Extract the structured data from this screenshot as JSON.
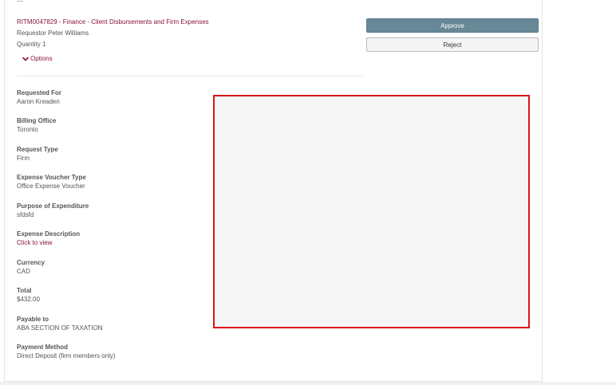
{
  "item": {
    "title": "RITM0047829 - Finance - Client Disbursements and Firm Expenses",
    "requestor": "Requestor Peter Williams",
    "quantity": "Quantity 1",
    "options_label": "Options"
  },
  "actions": {
    "approve_label": "Approve",
    "reject_label": "Reject"
  },
  "fields": [
    {
      "label": "Requested For",
      "value": "Aaron Kreaden"
    },
    {
      "label": "Billing Office",
      "value": "Toronto"
    },
    {
      "label": "Request Type",
      "value": "Firm"
    },
    {
      "label": "Expense Voucher Type",
      "value": "Office Expense Voucher"
    },
    {
      "label": "Purpose of Expenditure",
      "value": "sfdsfd"
    },
    {
      "label": "Expense Description",
      "value": "Click to view"
    },
    {
      "label": "Currency",
      "value": "CAD"
    },
    {
      "label": "Total",
      "value": "$432.00"
    },
    {
      "label": "Payable to",
      "value": "ABA SECTION OF TAXATION"
    },
    {
      "label": "Payment Method",
      "value": "Direct Deposit (firm members only)"
    }
  ],
  "colors": {
    "accent": "#8a1538",
    "approve": "#678896",
    "highlight_border": "#d9141a"
  },
  "icons": {
    "options": "chevron-down-icon"
  }
}
